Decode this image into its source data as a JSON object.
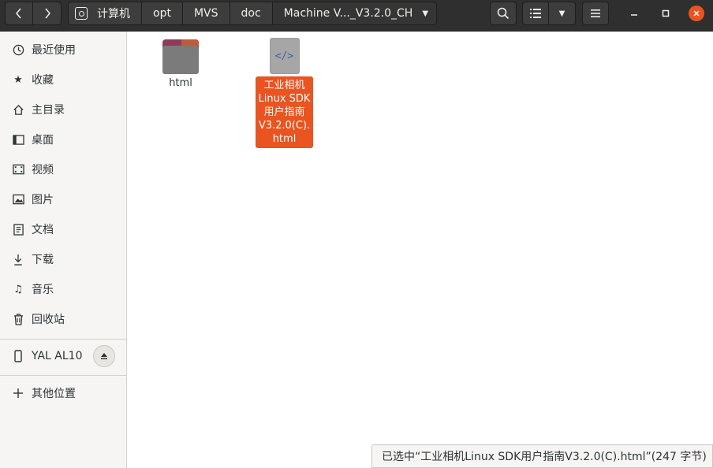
{
  "headerbar": {
    "back_icon": "chevron-left-icon",
    "forward_icon": "chevron-right-icon",
    "path": [
      {
        "label": "计算机",
        "icon": "disk-icon"
      },
      {
        "label": "opt"
      },
      {
        "label": "MVS"
      },
      {
        "label": "doc"
      },
      {
        "label": "Machine V..._V3.2.0_CH"
      }
    ],
    "search_icon": "search-icon",
    "view_icon": "list-view-icon",
    "view_dropdown_icon": "chevron-down-icon",
    "menu_icon": "hamburger-menu-icon",
    "window_controls": {
      "minimize": "minimize-icon",
      "maximize": "maximize-icon",
      "close": "close-icon",
      "close_color": "#e95420"
    }
  },
  "sidebar": {
    "items": [
      {
        "label": "最近使用",
        "icon": "clock-icon"
      },
      {
        "label": "收藏",
        "icon": "star-icon"
      },
      {
        "label": "主目录",
        "icon": "home-icon"
      },
      {
        "label": "桌面",
        "icon": "desktop-icon"
      },
      {
        "label": "视频",
        "icon": "video-icon"
      },
      {
        "label": "图片",
        "icon": "picture-icon"
      },
      {
        "label": "文档",
        "icon": "document-icon"
      },
      {
        "label": "下载",
        "icon": "download-icon"
      },
      {
        "label": "音乐",
        "icon": "music-icon"
      },
      {
        "label": "回收站",
        "icon": "trash-icon"
      }
    ],
    "device": {
      "label": "YAL AL10",
      "icon": "phone-icon",
      "eject_icon": "eject-icon"
    },
    "other": {
      "label": "其他位置",
      "icon": "plus-icon"
    }
  },
  "files": [
    {
      "name": "html",
      "type": "folder",
      "icon": "folder-icon"
    },
    {
      "name_lines": [
        "工业相机",
        "Linux SDK",
        "用户指南",
        "V3.2.0(C).",
        "html"
      ],
      "type": "html",
      "icon": "html-file-icon",
      "selected": true,
      "selection_color": "#e95420",
      "glyph": "</>"
    }
  ],
  "status": {
    "text": "已选中“工业相机Linux SDK用户指南V3.2.0(C).html”(247 字节)"
  }
}
